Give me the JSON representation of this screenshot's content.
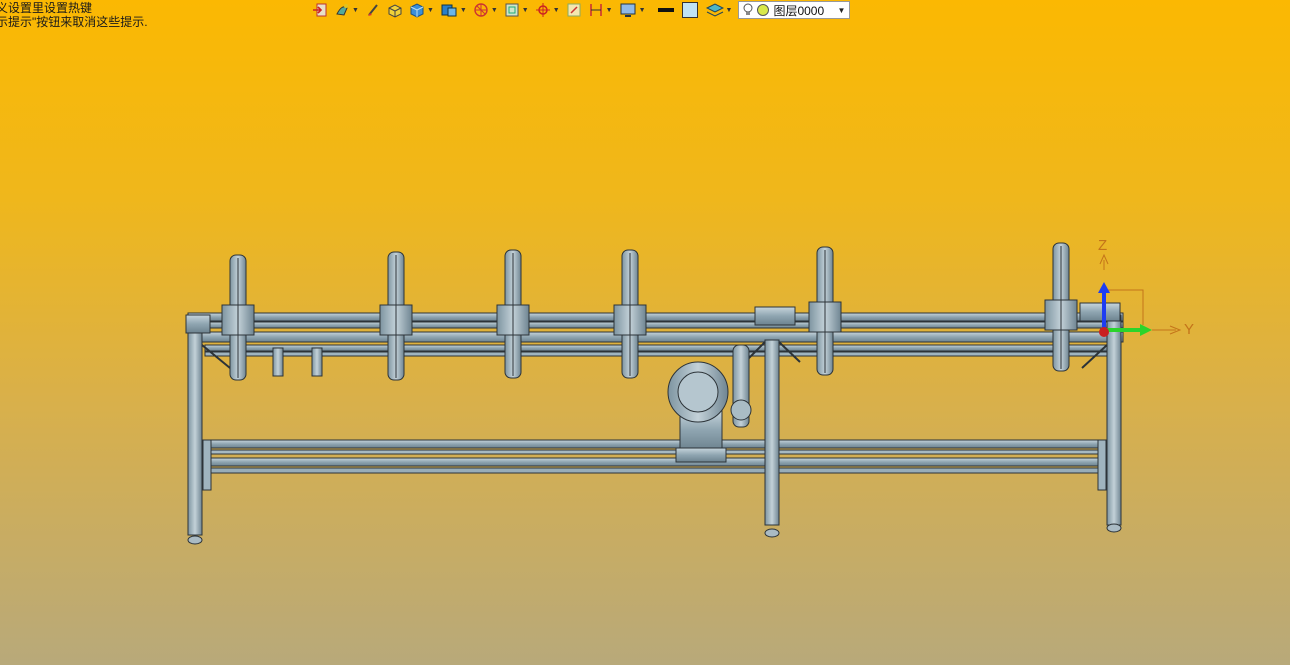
{
  "hint": {
    "line1": "义设置里设置热键",
    "line2": "示提示\"按钮来取消这些提示."
  },
  "toolbar": {
    "layer_value": "图层0000",
    "icons": [
      "exit-icon",
      "paint-icon",
      "brush-icon",
      "box-face-icon",
      "cube-icon",
      "view-cube-icon",
      "render-icon",
      "frame-icon",
      "snap-target-icon",
      "fit-icon",
      "section-icon",
      "monitor-icon",
      "line-style-icon",
      "fill-color-icon",
      "layer-stack-icon",
      "bulb-icon",
      "circle-icon"
    ]
  },
  "axis": {
    "z_label": "Z",
    "y_label": "Y"
  },
  "colors": {
    "bg_top": "#fbb802",
    "bg_bottom": "#b8a97a",
    "steel": "#9fb4bf",
    "outline": "#2c3338"
  }
}
